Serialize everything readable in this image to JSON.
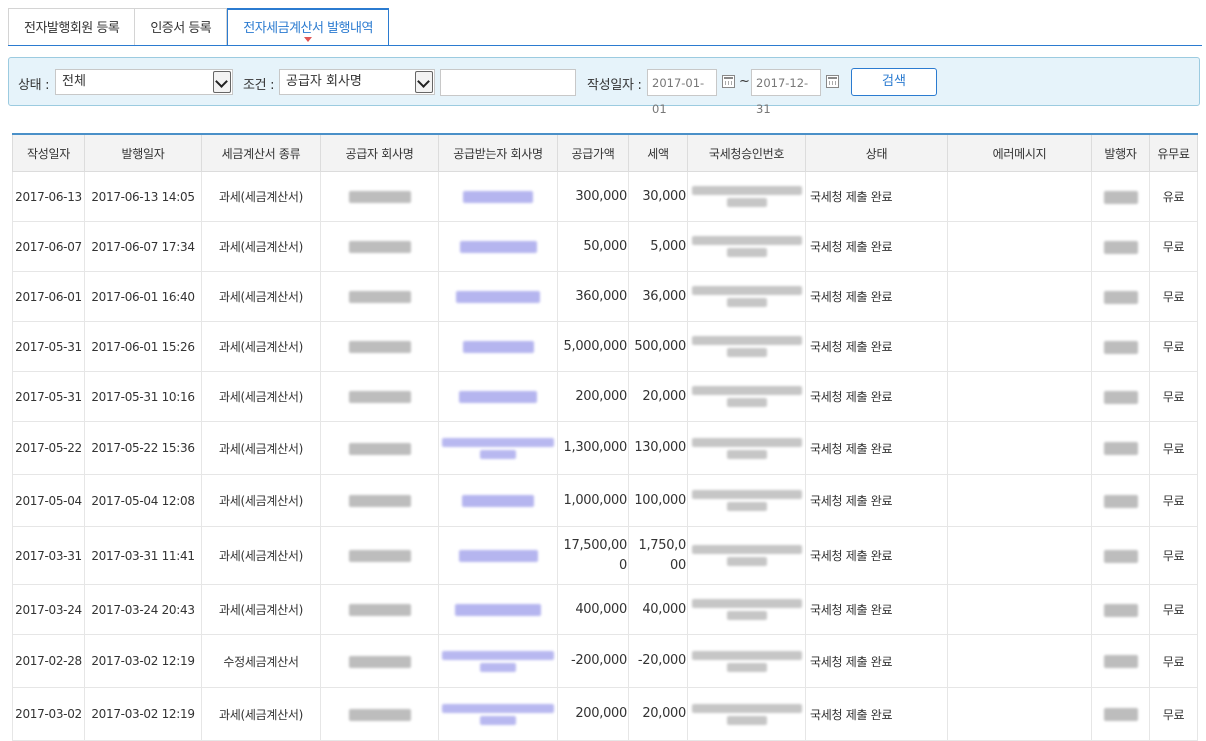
{
  "tabs": [
    {
      "label": "전자발행회원 등록",
      "active": false
    },
    {
      "label": "인증서 등록",
      "active": false
    },
    {
      "label": "전자세금계산서 발행내역",
      "active": true
    }
  ],
  "filter": {
    "status_label": "상태 :",
    "status_value": "전체",
    "condition_label": "조건 :",
    "condition_value": "공급자 회사명",
    "keyword_value": "",
    "date_label": "작성일자 :",
    "date_from": "2017-01-01",
    "date_sep": "~",
    "date_to": "2017-12-31",
    "search_button": "검색"
  },
  "table": {
    "headers": [
      "작성일자",
      "발행일자",
      "세금계산서 종류",
      "공급자 회사명",
      "공급받는자 회사명",
      "공급가액",
      "세액",
      "국세청승인번호",
      "상태",
      "에러메시지",
      "발행자",
      "유무료"
    ],
    "rows": [
      {
        "write_date": "2017-06-13",
        "issue_date": "2017-06-13 14:05",
        "type": "과세(세금계산서)",
        "supply": "300,000",
        "tax": "30,000",
        "status": "국세청 제출 완료",
        "error": "",
        "fee": "유료"
      },
      {
        "write_date": "2017-06-07",
        "issue_date": "2017-06-07 17:34",
        "type": "과세(세금계산서)",
        "supply": "50,000",
        "tax": "5,000",
        "status": "국세청 제출 완료",
        "error": "",
        "fee": "무료"
      },
      {
        "write_date": "2017-06-01",
        "issue_date": "2017-06-01 16:40",
        "type": "과세(세금계산서)",
        "supply": "360,000",
        "tax": "36,000",
        "status": "국세청 제출 완료",
        "error": "",
        "fee": "무료"
      },
      {
        "write_date": "2017-05-31",
        "issue_date": "2017-06-01 15:26",
        "type": "과세(세금계산서)",
        "supply": "5,000,000",
        "tax": "500,000",
        "status": "국세청 제출 완료",
        "error": "",
        "fee": "무료"
      },
      {
        "write_date": "2017-05-31",
        "issue_date": "2017-05-31 10:16",
        "type": "과세(세금계산서)",
        "supply": "200,000",
        "tax": "20,000",
        "status": "국세청 제출 완료",
        "error": "",
        "fee": "무료"
      },
      {
        "write_date": "2017-05-22",
        "issue_date": "2017-05-22 15:36",
        "type": "과세(세금계산서)",
        "supply": "1,300,000",
        "tax": "130,000",
        "status": "국세청 제출 완료",
        "error": "",
        "fee": "무료"
      },
      {
        "write_date": "2017-05-04",
        "issue_date": "2017-05-04 12:08",
        "type": "과세(세금계산서)",
        "supply": "1,000,000",
        "tax": "100,000",
        "status": "국세청 제출 완료",
        "error": "",
        "fee": "무료"
      },
      {
        "write_date": "2017-03-31",
        "issue_date": "2017-03-31 11:41",
        "type": "과세(세금계산서)",
        "supply": "17,500,000",
        "tax": "1,750,000",
        "status": "국세청 제출 완료",
        "error": "",
        "fee": "무료"
      },
      {
        "write_date": "2017-03-24",
        "issue_date": "2017-03-24 20:43",
        "type": "과세(세금계산서)",
        "supply": "400,000",
        "tax": "40,000",
        "status": "국세청 제출 완료",
        "error": "",
        "fee": "무료"
      },
      {
        "write_date": "2017-02-28",
        "issue_date": "2017-03-02 12:19",
        "type": "수정세금계산서",
        "supply": "-200,000",
        "tax": "-20,000",
        "status": "국세청 제출 완료",
        "error": "",
        "fee": "무료"
      },
      {
        "write_date": "2017-03-02",
        "issue_date": "2017-03-02 12:19",
        "type": "과세(세금계산서)",
        "supply": "200,000",
        "tax": "20,000",
        "status": "국세청 제출 완료",
        "error": "",
        "fee": "무료"
      }
    ]
  },
  "colors": {
    "accent": "#2b7bd0",
    "filter_bg": "#e6f3fa",
    "filter_border": "#9ccbe0",
    "tab_caret": "#e05555"
  },
  "icons": {
    "date_picker": "calendar-icon",
    "select": "chevron-down-icon"
  }
}
